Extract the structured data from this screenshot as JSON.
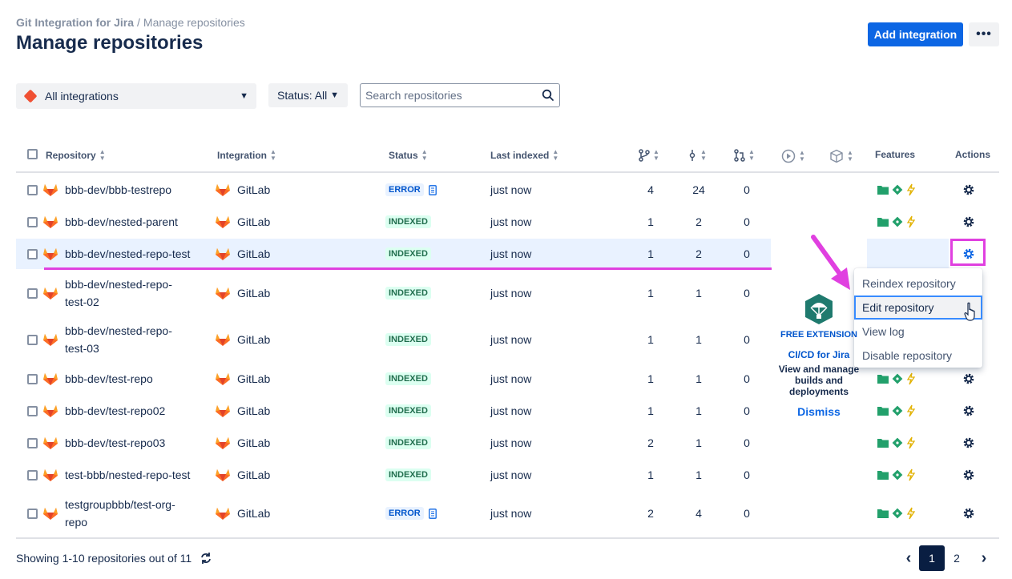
{
  "breadcrumb": {
    "root": "Git Integration for Jira",
    "separator": "/",
    "current": "Manage repositories"
  },
  "page_title": "Manage repositories",
  "header_actions": {
    "add_integration": "Add integration",
    "more": "•••"
  },
  "filters": {
    "integrations": "All integrations",
    "status": "Status: All",
    "search_placeholder": "Search repositories"
  },
  "columns": {
    "repository": "Repository",
    "integration": "Integration",
    "status": "Status",
    "last_indexed": "Last indexed",
    "branches_icon": "branch-icon",
    "commits_icon": "commit-icon",
    "pull_requests_icon": "pull-request-icon",
    "builds_icon": "play-icon",
    "deployments_icon": "box-icon",
    "features": "Features",
    "actions": "Actions"
  },
  "rows": [
    {
      "repo": "bbb-dev/bbb-testrepo",
      "repo_l2": "",
      "integration": "GitLab",
      "status": "ERROR",
      "last_indexed": "just now",
      "branches": "4",
      "commits": "24",
      "prs": "0"
    },
    {
      "repo": "bbb-dev/nested-parent",
      "repo_l2": "",
      "integration": "GitLab",
      "status": "INDEXED",
      "last_indexed": "just now",
      "branches": "1",
      "commits": "2",
      "prs": "0"
    },
    {
      "repo": "bbb-dev/nested-repo-test",
      "repo_l2": "",
      "integration": "GitLab",
      "status": "INDEXED",
      "last_indexed": "just now",
      "branches": "1",
      "commits": "2",
      "prs": "0"
    },
    {
      "repo": "bbb-dev/nested-repo-",
      "repo_l2": "test-02",
      "integration": "GitLab",
      "status": "INDEXED",
      "last_indexed": "just now",
      "branches": "1",
      "commits": "1",
      "prs": "0"
    },
    {
      "repo": "bbb-dev/nested-repo-",
      "repo_l2": "test-03",
      "integration": "GitLab",
      "status": "INDEXED",
      "last_indexed": "just now",
      "branches": "1",
      "commits": "1",
      "prs": "0"
    },
    {
      "repo": "bbb-dev/test-repo",
      "repo_l2": "",
      "integration": "GitLab",
      "status": "INDEXED",
      "last_indexed": "just now",
      "branches": "1",
      "commits": "1",
      "prs": "0"
    },
    {
      "repo": "bbb-dev/test-repo02",
      "repo_l2": "",
      "integration": "GitLab",
      "status": "INDEXED",
      "last_indexed": "just now",
      "branches": "1",
      "commits": "1",
      "prs": "0"
    },
    {
      "repo": "bbb-dev/test-repo03",
      "repo_l2": "",
      "integration": "GitLab",
      "status": "INDEXED",
      "last_indexed": "just now",
      "branches": "2",
      "commits": "1",
      "prs": "0"
    },
    {
      "repo": "test-bbb/nested-repo-test",
      "repo_l2": "",
      "integration": "GitLab",
      "status": "INDEXED",
      "last_indexed": "just now",
      "branches": "1",
      "commits": "1",
      "prs": "0"
    },
    {
      "repo": "testgroupbbb/test-org-",
      "repo_l2": "repo",
      "integration": "GitLab",
      "status": "ERROR",
      "last_indexed": "just now",
      "branches": "2",
      "commits": "4",
      "prs": "0"
    }
  ],
  "action_menu": {
    "items": [
      "Reindex repository",
      "Edit repository",
      "View log",
      "Disable repository"
    ],
    "active": "Edit repository"
  },
  "promo": {
    "tag": "FREE EXTENSION",
    "title": "CI/CD for Jira",
    "description": "View and manage builds and deployments",
    "dismiss": "Dismiss"
  },
  "footer": {
    "showing": "Showing 1-10 repositories out of 11"
  },
  "pagination": {
    "prev": "‹",
    "pages": [
      "1",
      "2"
    ],
    "current": "1",
    "next": "›"
  },
  "colors": {
    "accent": "#0c66e4",
    "highlight": "#e040e0",
    "gitlab": "#fc6d26",
    "indexed_bg": "#dcfff1",
    "error_bg": "#e9f2ff"
  }
}
